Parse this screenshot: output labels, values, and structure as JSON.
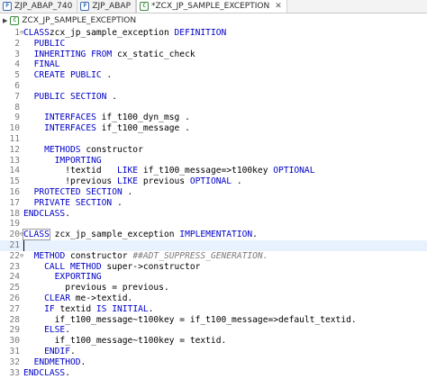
{
  "tabs": [
    {
      "label": "ZJP_ABAP_740",
      "icon": "program-icon",
      "active": false
    },
    {
      "label": "ZJP_ABAP",
      "icon": "program-icon",
      "active": false
    },
    {
      "label": "*ZCX_JP_SAMPLE_EXCEPTION",
      "icon": "class-icon",
      "active": true,
      "close": "✕"
    }
  ],
  "breadcrumb": {
    "label": "ZCX_JP_SAMPLE_EXCEPTION",
    "arrow": "▶"
  },
  "editor": {
    "current_line": 21,
    "lines": [
      {
        "n": "1",
        "fold": "⊖",
        "segs": [
          [
            "kw",
            "CLASS"
          ],
          [
            "",
            "zcx_jp_sample_exception "
          ],
          [
            "kw",
            "DEFINITION"
          ]
        ]
      },
      {
        "n": "2",
        "fold": "",
        "segs": [
          [
            "",
            "  "
          ],
          [
            "kw",
            "PUBLIC"
          ]
        ]
      },
      {
        "n": "3",
        "fold": "",
        "segs": [
          [
            "",
            "  "
          ],
          [
            "kw",
            "INHERITING FROM"
          ],
          [
            "",
            "",
            " cx_static_check"
          ]
        ]
      },
      {
        "n": "4",
        "fold": "",
        "segs": [
          [
            "",
            "  "
          ],
          [
            "kw",
            "FINAL"
          ]
        ]
      },
      {
        "n": "5",
        "fold": "",
        "segs": [
          [
            "",
            "  "
          ],
          [
            "kw",
            "CREATE PUBLIC"
          ],
          [
            "",
            " ."
          ]
        ]
      },
      {
        "n": "6",
        "fold": "",
        "segs": [
          [
            "",
            ""
          ]
        ]
      },
      {
        "n": "7",
        "fold": "",
        "segs": [
          [
            "",
            "  "
          ],
          [
            "kw",
            "PUBLIC SECTION"
          ],
          [
            "",
            " ."
          ]
        ]
      },
      {
        "n": "8",
        "fold": "",
        "segs": [
          [
            "",
            ""
          ]
        ]
      },
      {
        "n": "9",
        "fold": "",
        "segs": [
          [
            "",
            "    "
          ],
          [
            "kw",
            "INTERFACES"
          ],
          [
            "",
            " if_t100_dyn_msg ."
          ]
        ]
      },
      {
        "n": "10",
        "fold": "",
        "segs": [
          [
            "",
            "    "
          ],
          [
            "kw",
            "INTERFACES"
          ],
          [
            "",
            " if_t100_message ."
          ]
        ]
      },
      {
        "n": "11",
        "fold": "",
        "segs": [
          [
            "",
            ""
          ]
        ]
      },
      {
        "n": "12",
        "fold": "",
        "segs": [
          [
            "",
            "    "
          ],
          [
            "kw",
            "METHODS"
          ],
          [
            "",
            " constructor"
          ]
        ]
      },
      {
        "n": "13",
        "fold": "",
        "segs": [
          [
            "",
            "      "
          ],
          [
            "kw",
            "IMPORTING"
          ]
        ]
      },
      {
        "n": "14",
        "fold": "",
        "segs": [
          [
            "",
            "        !textid   "
          ],
          [
            "kw",
            "LIKE"
          ],
          [
            "",
            " if_t100_message=>t100key "
          ],
          [
            "kw",
            "OPTIONAL"
          ]
        ]
      },
      {
        "n": "15",
        "fold": "",
        "segs": [
          [
            "",
            "        !previous "
          ],
          [
            "kw",
            "LIKE"
          ],
          [
            "",
            " previous "
          ],
          [
            "kw",
            "OPTIONAL"
          ],
          [
            "",
            " ."
          ]
        ]
      },
      {
        "n": "16",
        "fold": "",
        "segs": [
          [
            "",
            "  "
          ],
          [
            "kw",
            "PROTECTED SECTION"
          ],
          [
            "",
            " ."
          ]
        ]
      },
      {
        "n": "17",
        "fold": "",
        "segs": [
          [
            "",
            "  "
          ],
          [
            "kw",
            "PRIVATE SECTION"
          ],
          [
            "",
            " ."
          ]
        ]
      },
      {
        "n": "18",
        "fold": "",
        "segs": [
          [
            "kw",
            "ENDCLASS"
          ],
          [
            "",
            "."
          ]
        ]
      },
      {
        "n": "19",
        "fold": "",
        "segs": [
          [
            "",
            ""
          ]
        ]
      },
      {
        "n": "20",
        "fold": "⊖",
        "segs": [
          [
            "kw",
            "CLASS"
          ],
          [
            "",
            "",
            " zcx_jp_sample_exception "
          ],
          [
            "kw",
            "IMPLEMENTATION"
          ],
          [
            "",
            "."
          ]
        ]
      },
      {
        "n": "21",
        "fold": "",
        "segs": [
          [
            "",
            ""
          ]
        ]
      },
      {
        "n": "22",
        "fold": "⊖",
        "segs": [
          [
            "",
            "  "
          ],
          [
            "kw",
            "METHOD"
          ],
          [
            "",
            " constructor "
          ],
          [
            "cm",
            "##ADT_SUPPRESS_GENERATION."
          ]
        ]
      },
      {
        "n": "23",
        "fold": "",
        "segs": [
          [
            "",
            "    "
          ],
          [
            "kw",
            "CALL METHOD"
          ],
          [
            "",
            " super->constructor"
          ]
        ]
      },
      {
        "n": "24",
        "fold": "",
        "segs": [
          [
            "",
            "      "
          ],
          [
            "kw",
            "EXPORTING"
          ]
        ]
      },
      {
        "n": "25",
        "fold": "",
        "segs": [
          [
            "",
            "        previous = previous."
          ]
        ]
      },
      {
        "n": "26",
        "fold": "",
        "segs": [
          [
            "",
            "    "
          ],
          [
            "kw",
            "CLEAR"
          ],
          [
            "",
            " me->textid."
          ]
        ]
      },
      {
        "n": "27",
        "fold": "",
        "segs": [
          [
            "",
            "    "
          ],
          [
            "kw",
            "IF"
          ],
          [
            "",
            " textid "
          ],
          [
            "kw",
            "IS INITIAL"
          ],
          [
            "",
            "."
          ]
        ]
      },
      {
        "n": "28",
        "fold": "",
        "segs": [
          [
            "",
            "      if_t100_message~t100key = if_t100_message=>default_textid."
          ]
        ]
      },
      {
        "n": "29",
        "fold": "",
        "segs": [
          [
            "",
            "    "
          ],
          [
            "kw",
            "ELSE"
          ],
          [
            "",
            "."
          ]
        ]
      },
      {
        "n": "30",
        "fold": "",
        "segs": [
          [
            "",
            "      if_t100_message~t100key = textid."
          ]
        ]
      },
      {
        "n": "31",
        "fold": "",
        "segs": [
          [
            "",
            "    "
          ],
          [
            "kw",
            "ENDIF"
          ],
          [
            "",
            "."
          ]
        ]
      },
      {
        "n": "32",
        "fold": "",
        "segs": [
          [
            "",
            "  "
          ],
          [
            "kw",
            "ENDMETHOD"
          ],
          [
            "",
            "."
          ]
        ]
      },
      {
        "n": "33",
        "fold": "",
        "segs": [
          [
            "kw",
            "ENDCLASS"
          ],
          [
            "",
            "."
          ]
        ]
      }
    ]
  }
}
